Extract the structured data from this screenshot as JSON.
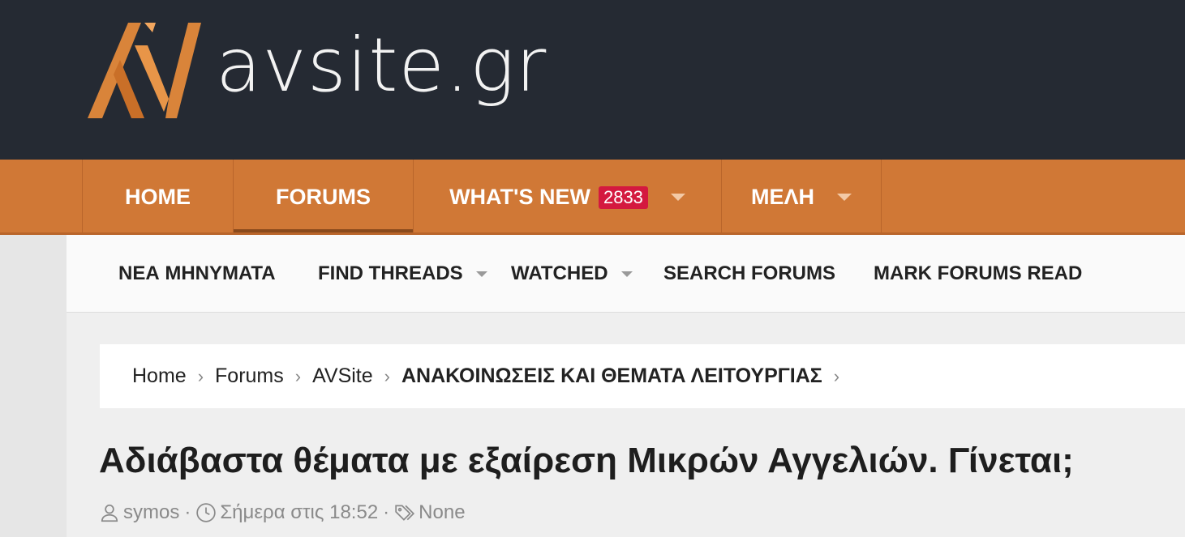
{
  "brand": {
    "name": "avsite.gr"
  },
  "colors": {
    "header_bg": "#252a33",
    "nav_bg": "#d07836",
    "badge_bg": "#d4193f"
  },
  "nav": {
    "home": "HOME",
    "forums": "FORUMS",
    "whats_new": "WHAT'S NEW",
    "whats_new_count": "2833",
    "members": "ΜΕΛΗ"
  },
  "subnav": {
    "new_posts": "ΝΕΑ ΜΗΝΥΜΑΤΑ",
    "find_threads": "FIND THREADS",
    "watched": "WATCHED",
    "search_forums": "SEARCH FORUMS",
    "mark_read": "MARK FORUMS READ"
  },
  "breadcrumb": {
    "items": [
      "Home",
      "Forums",
      "AVSite",
      "ΑΝΑΚΟΙΝΩΣΕΙΣ ΚΑΙ ΘΕΜΑΤΑ ΛΕΙΤΟΥΡΓΙΑΣ"
    ],
    "separator": "›"
  },
  "thread": {
    "title": "Αδιάβαστα θέματα με εξαίρεση Μικρών Αγγελιών. Γίνεται;",
    "author": "symos",
    "date": "Σήμερα στις 18:52",
    "tags": "None",
    "separator": "·"
  },
  "icons": [
    "user-icon",
    "clock-icon",
    "tags-icon",
    "chevron-down-icon"
  ]
}
